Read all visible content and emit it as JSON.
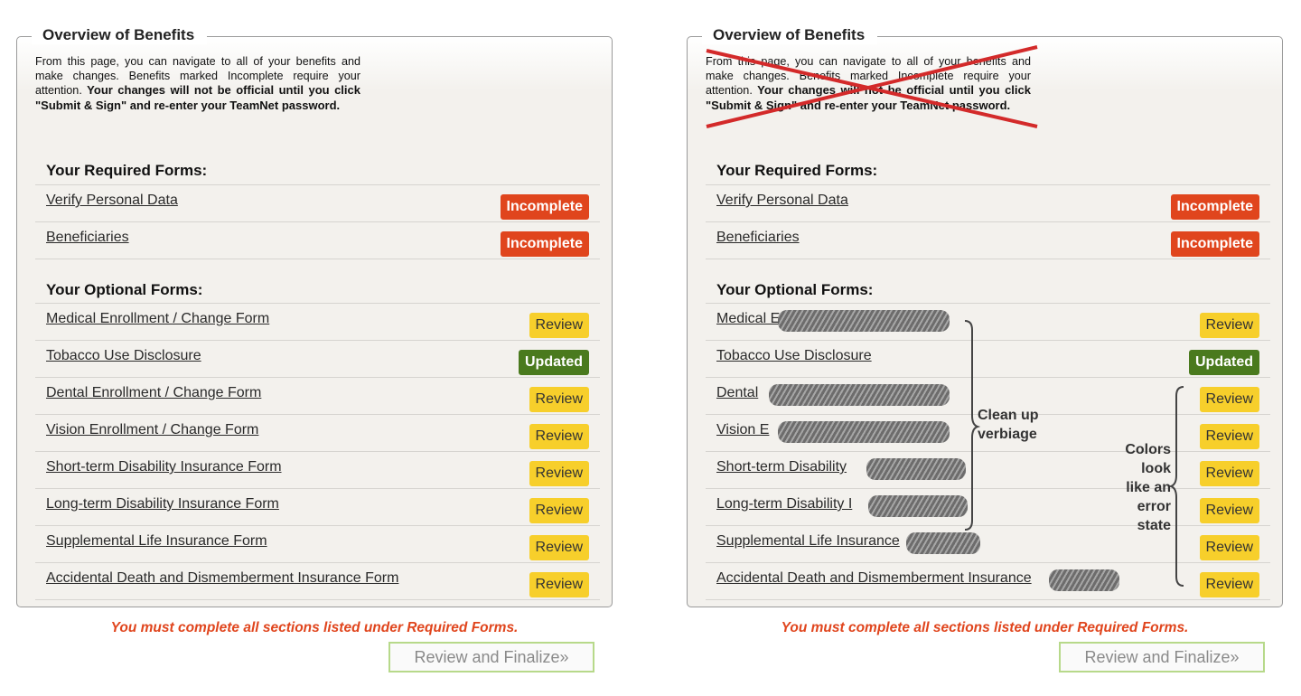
{
  "panels": [
    {
      "legend": "Overview of Benefits",
      "intro_plain": "From this page, you can navigate to all of your benefits and make changes. Benefits marked Incomplete require your attention. ",
      "intro_bold": "Your changes will not be official until you click \"Submit & Sign\" and re-enter your TeamNet password.",
      "required_title": "Your Required Forms:",
      "optional_title": "Your Optional Forms:",
      "required": [
        {
          "label": "Verify Personal Data",
          "status": "Incomplete"
        },
        {
          "label": "Beneficiaries",
          "status": "Incomplete"
        }
      ],
      "optional": [
        {
          "label": "Medical Enrollment / Change Form",
          "status": "Review"
        },
        {
          "label": "Tobacco Use Disclosure",
          "status": "Updated"
        },
        {
          "label": "Dental Enrollment / Change Form",
          "status": "Review"
        },
        {
          "label": "Vision Enrollment / Change Form",
          "status": "Review"
        },
        {
          "label": "Short-term Disability Insurance Form",
          "status": "Review"
        },
        {
          "label": "Long-term Disability Insurance Form",
          "status": "Review"
        },
        {
          "label": "Supplemental Life Insurance Form",
          "status": "Review"
        },
        {
          "label": "Accidental Death and Dismemberment Insurance Form",
          "status": "Review"
        }
      ],
      "required_message": "You must complete all sections listed under Required Forms.",
      "finalize_label": "Review and Finalize»"
    },
    {
      "legend": "Overview of Benefits",
      "intro_plain": "From this page, you can navigate to all of your benefits and make changes. Benefits marked Incomplete require your attention. ",
      "intro_bold": "Your changes will not be official until you click \"Submit & Sign\" and re-enter your TeamNet password.",
      "required_title": "Your Required Forms:",
      "optional_title": "Your Optional Forms:",
      "required": [
        {
          "label": "Verify Personal Data",
          "status": "Incomplete"
        },
        {
          "label": "Beneficiaries",
          "status": "Incomplete"
        }
      ],
      "optional": [
        {
          "label": "Medical E",
          "status": "Review"
        },
        {
          "label": "Tobacco Use Disclosure",
          "status": "Updated"
        },
        {
          "label": "Dental",
          "status": "Review"
        },
        {
          "label": "Vision E",
          "status": "Review"
        },
        {
          "label": "Short-term Disability",
          "status": "Review"
        },
        {
          "label": "Long-term Disability I",
          "status": "Review"
        },
        {
          "label": "Supplemental Life Insurance",
          "status": "Review"
        },
        {
          "label": "Accidental Death and Dismemberment Insurance",
          "status": "Review"
        }
      ],
      "required_message": "You must complete all sections listed under Required Forms.",
      "finalize_label": "Review and Finalize»"
    }
  ],
  "annotations": {
    "clean_up": [
      "Clean up",
      "verbiage"
    ],
    "colors": [
      "Colors",
      "look",
      "like an",
      "error",
      "state"
    ]
  },
  "colors": {
    "incomplete": "#e0451d",
    "updated": "#4a7a1e",
    "review": "#f7cf2b",
    "annotation_red": "#d32a2a"
  }
}
